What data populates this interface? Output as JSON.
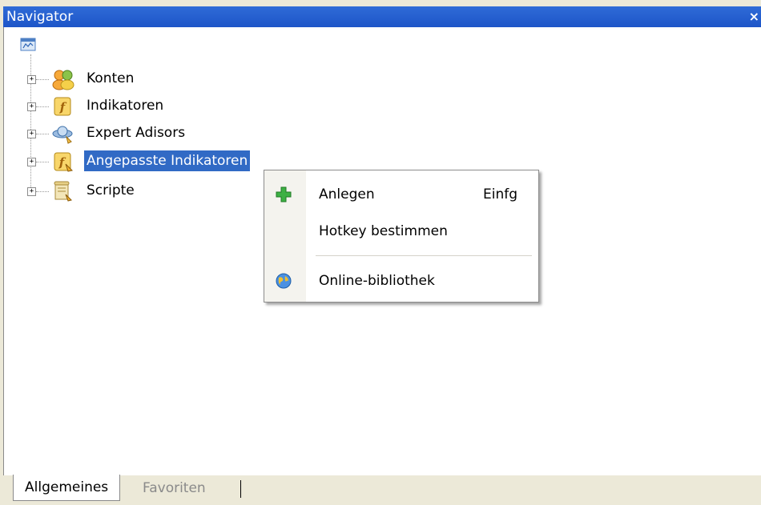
{
  "window": {
    "title": "Navigator",
    "close_glyph": "×"
  },
  "tree": {
    "root_icon": "terminal-icon",
    "items": [
      {
        "label": "Konten",
        "icon": "accounts-icon",
        "expander": "+"
      },
      {
        "label": "Indikatoren",
        "icon": "indicator-icon",
        "expander": "+"
      },
      {
        "label": "Expert Adisors",
        "icon": "expert-advisor-icon",
        "expander": "+"
      },
      {
        "label": "Angepasste Indikatoren",
        "icon": "custom-indicator-icon",
        "expander": "+",
        "selected": true
      },
      {
        "label": "Scripte",
        "icon": "script-icon",
        "expander": "+"
      }
    ]
  },
  "context_menu": {
    "items": [
      {
        "label": "Anlegen",
        "shortcut": "Einfg",
        "icon": "plus-icon"
      },
      {
        "label": "Hotkey bestimmen",
        "shortcut": ""
      },
      {
        "label": "Online-bibliothek",
        "shortcut": "",
        "icon": "globe-icon"
      }
    ]
  },
  "tabs": [
    {
      "label": "Allgemeines",
      "active": true
    },
    {
      "label": "Favoriten",
      "active": false
    }
  ],
  "colors": {
    "titlebar": "#1d55c8",
    "selection": "#316ac5",
    "face": "#ece9d8"
  }
}
